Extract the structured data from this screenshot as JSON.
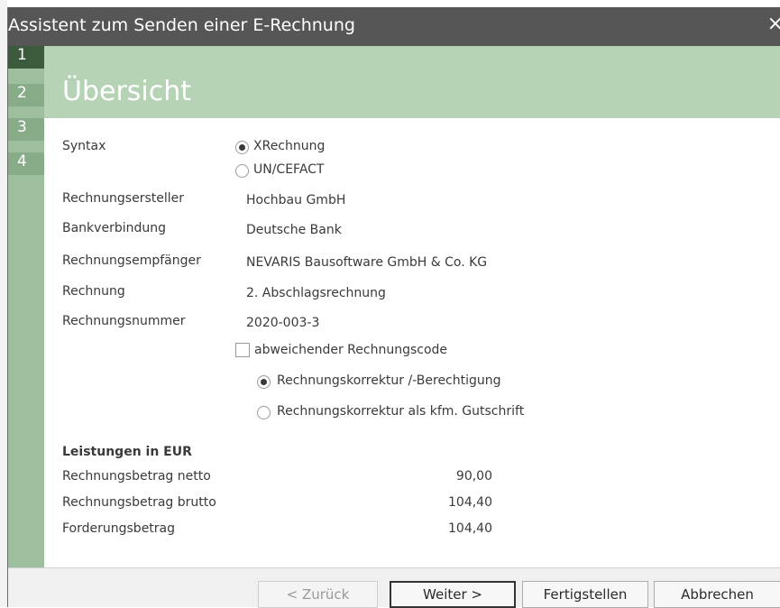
{
  "window": {
    "title": "Assistent zum Senden einer E-Rechnung",
    "close_glyph": "×"
  },
  "steps": [
    "1",
    "2",
    "3",
    "4"
  ],
  "page_title": "Übersicht",
  "syntax": {
    "label": "Syntax",
    "options": [
      "XRechnung",
      "UN/CEFACT"
    ],
    "selected": "XRechnung"
  },
  "fields": [
    {
      "label": "Rechnungsersteller",
      "value": "Hochbau GmbH"
    },
    {
      "label": "Bankverbindung",
      "value": "Deutsche Bank"
    },
    {
      "label": "Rechnungsempfänger",
      "value": "NEVARIS Bausoftware GmbH & Co. KG"
    },
    {
      "label": "Rechnung",
      "value": "2. Abschlagsrechnung"
    },
    {
      "label": "Rechnungsnummer",
      "value": "2020-003-3"
    }
  ],
  "alt_code": {
    "checkbox_label": "abweichender Rechnungscode",
    "checked": false,
    "options": [
      "Rechnungskorrektur /-Berechtigung",
      "Rechnungskorrektur als kfm. Gutschrift"
    ],
    "selected": "Rechnungskorrektur /-Berechtigung"
  },
  "amounts": {
    "heading": "Leistungen in EUR",
    "rows": [
      {
        "label": "Rechnungsbetrag netto",
        "value": "90,00"
      },
      {
        "label": "Rechnungsbetrag brutto",
        "value": "104,40"
      },
      {
        "label": "Forderungsbetrag",
        "value": "104,40"
      }
    ]
  },
  "buttons": {
    "back": "< Zurück",
    "next": "Weiter >",
    "finish": "Fertigstellen",
    "cancel": "Abbrechen"
  },
  "colors": {
    "titlebar": "#565656",
    "banner": "#b6d3b6",
    "step_active": "#3c5a3c",
    "step_bar": "#9ebf9e"
  }
}
